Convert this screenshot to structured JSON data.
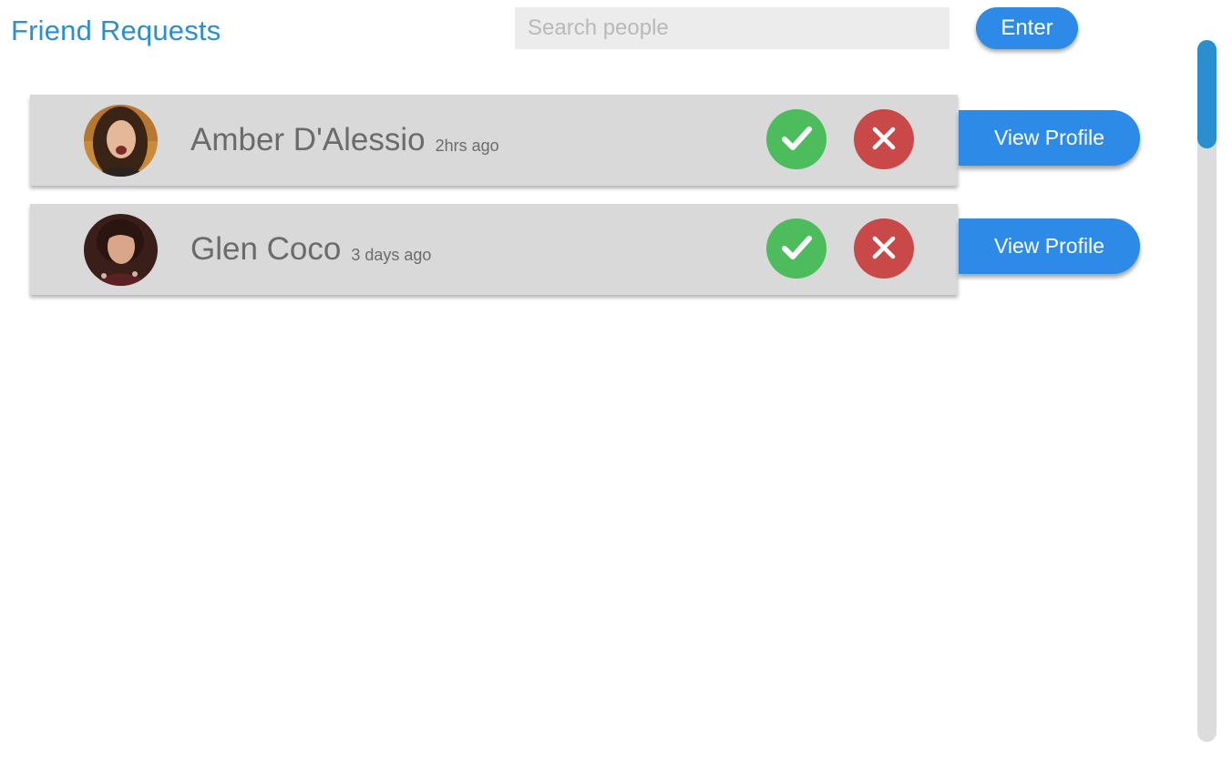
{
  "header": {
    "title": "Friend Requests",
    "search_placeholder": "Search people",
    "search_value": "",
    "enter_label": "Enter"
  },
  "requests": [
    {
      "name": "Amber D'Alessio",
      "time": "2hrs ago",
      "view_profile_label": "View Profile",
      "accept_icon": "check-icon",
      "decline_icon": "close-icon"
    },
    {
      "name": "Glen Coco",
      "time": "3 days ago",
      "view_profile_label": "View Profile",
      "accept_icon": "check-icon",
      "decline_icon": "close-icon"
    }
  ],
  "colors": {
    "title": "#2b8fcf",
    "primary_button": "#2d8ae6",
    "accept": "#4cbc5c",
    "decline": "#c94848",
    "row_background": "#d9d9d9",
    "scroll_thumb": "#2b8fcf"
  },
  "scrollbar": {
    "position_fraction": 0.0
  }
}
